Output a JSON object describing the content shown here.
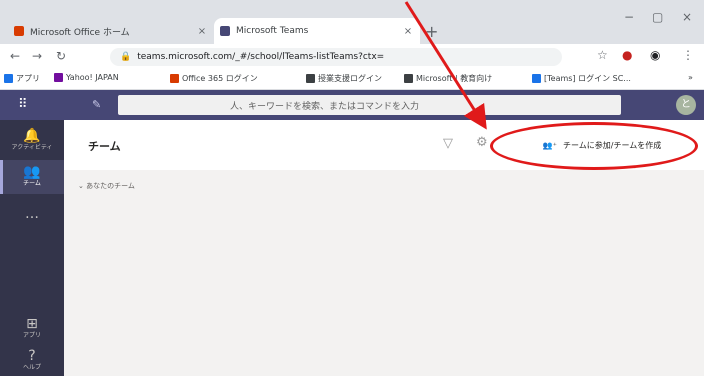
{
  "browser": {
    "tabs": [
      {
        "title": "Microsoft Office ホーム",
        "close": "×",
        "favicon_color": "#d83b01"
      },
      {
        "title": "Microsoft Teams",
        "close": "×",
        "favicon_color": "#464775"
      }
    ],
    "new_tab": "+",
    "window_controls": {
      "minimize": "−",
      "maximize": "▢",
      "close": "×"
    },
    "address": "teams.microsoft.com/_#/school/lTeams-listTeams?ctx=",
    "bookmarks": [
      {
        "label": "アプリ",
        "color": "#1a73e8"
      },
      {
        "label": "Yahoo! JAPAN",
        "color": "#720e9e"
      },
      {
        "label": "Office 365 ログイン",
        "color": "#d83b01"
      },
      {
        "label": "授業支援ログイン",
        "color": "#3c4043"
      },
      {
        "label": "Microsoft | 教育向け",
        "color": "#3c4043"
      },
      {
        "label": "[Teams] ログイン SC...",
        "color": "#1a73e8"
      }
    ]
  },
  "teams": {
    "search_placeholder": "人、キーワードを検索、またはコマンドを入力",
    "avatar_initial": "と",
    "rail": [
      {
        "label": "アクティビティ"
      },
      {
        "label": "チーム"
      },
      {
        "label": "…"
      },
      {
        "label": "アプリ"
      },
      {
        "label": "ヘルプ"
      }
    ],
    "panel_title": "チーム",
    "join_button": "チームに参加/チームを作成",
    "section_label": "あなたのチーム"
  },
  "colors": {
    "teams_purple": "#464775",
    "rail": "#33344a",
    "annotation_red": "#e01a1a"
  }
}
